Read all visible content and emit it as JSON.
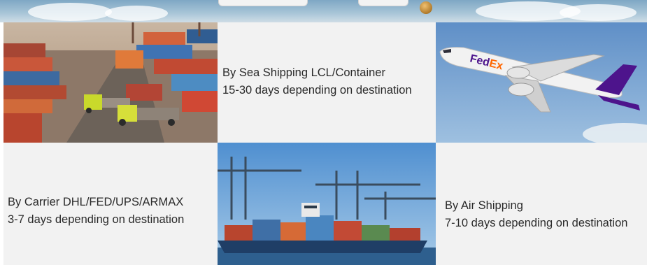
{
  "tiles": {
    "sea": {
      "line1": "By Sea Shipping LCL/Container",
      "line2": "15-30 days depending on destination"
    },
    "carrier": {
      "line1": "By Carrier DHL/FED/UPS/ARMAX",
      "line2": "3-7 days depending on destination"
    },
    "air": {
      "line1": "By Air Shipping",
      "line2": "7-10 days depending on destination"
    },
    "plane_logo": {
      "fed": "Fed",
      "ex": "Ex"
    }
  },
  "colors": {
    "caption_bg": "#f2f2f2",
    "fedex_purple": "#4d148c",
    "fedex_orange": "#ff6600"
  }
}
